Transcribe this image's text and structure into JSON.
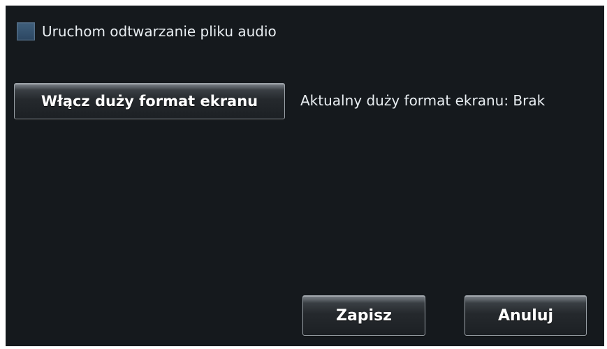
{
  "audio": {
    "checkbox_label": "Uruchom odtwarzanie pliku audio",
    "checked": false
  },
  "big_screen": {
    "button_label": "Włącz duży format ekranu",
    "status_text": "Aktualny duży format ekranu: Brak"
  },
  "actions": {
    "save_label": "Zapisz",
    "cancel_label": "Anuluj"
  },
  "colors": {
    "panel_background": "#15191d",
    "text": "#e9eef2",
    "checkbox_fill": "#3f5e7b"
  }
}
